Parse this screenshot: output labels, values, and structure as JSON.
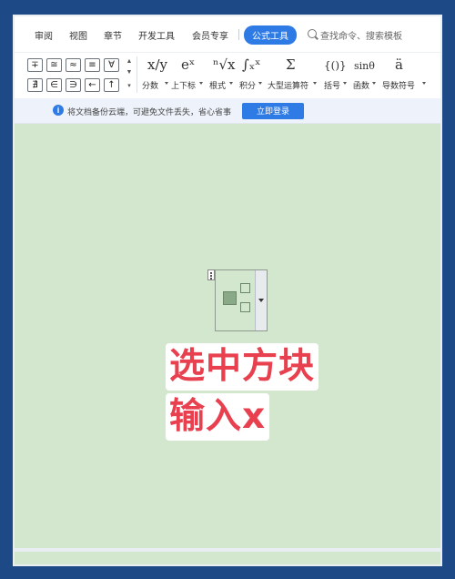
{
  "tabs": [
    {
      "label": "审阅"
    },
    {
      "label": "视图"
    },
    {
      "label": "章节"
    },
    {
      "label": "开发工具"
    },
    {
      "label": "会员专享"
    },
    {
      "label": "公式工具",
      "active": true
    }
  ],
  "search": {
    "placeholder": "查找命令、搜索模板"
  },
  "symbols": {
    "row1": [
      "∓",
      "≅",
      "≈",
      "≡",
      "∀"
    ],
    "row2": [
      "∄",
      "∈",
      "∋",
      "←",
      "↑"
    ]
  },
  "tools": [
    {
      "icon": "x/y",
      "label": "分数"
    },
    {
      "icon": "eˣ",
      "label": "上下标"
    },
    {
      "icon": "ⁿ√x",
      "label": "根式"
    },
    {
      "icon": "∫ₓˣ",
      "label": "积分"
    },
    {
      "icon": "Σ",
      "label": "大型运算符"
    },
    {
      "icon": "{()}",
      "label": "括号"
    },
    {
      "icon": "sinθ",
      "label": "函数"
    },
    {
      "icon": "ä",
      "label": "导数符号"
    }
  ],
  "notification": {
    "text": "将文档备份云端，可避免文件丢失，省心省事",
    "button": "立即登录"
  },
  "captions": {
    "line1": "选中方块",
    "line2": "输入x"
  },
  "colors": {
    "accent": "#2f7be5",
    "canvas": "#d3e7cf",
    "caption_text": "#e8404f",
    "frame": "#1d4a86"
  }
}
